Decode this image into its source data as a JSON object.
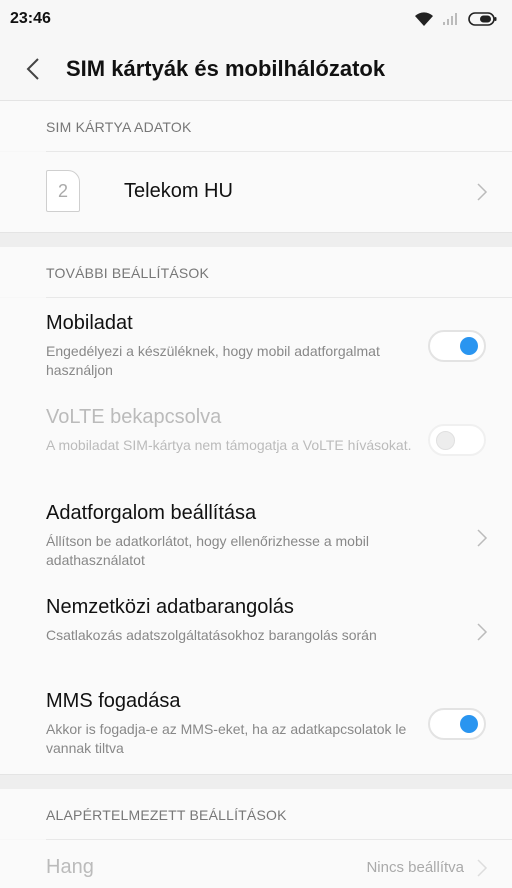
{
  "status": {
    "time": "23:46"
  },
  "header": {
    "title": "SIM kártyák és mobilhálózatok"
  },
  "sim_section": {
    "label": "SIM KÁRTYA ADATOK",
    "sim": {
      "slot_number": "2",
      "operator": "Telekom HU"
    }
  },
  "more_section": {
    "label": "TOVÁBBI BEÁLLÍTÁSOK",
    "items": [
      {
        "title": "Mobiladat",
        "subtitle": "Engedélyezi a készüléknek, hogy mobil adatforgalmat használjon",
        "toggle": "on"
      },
      {
        "title": "VoLTE bekapcsolva",
        "subtitle": "A mobiladat SIM-kártya nem támogatja a VoLTE hívásokat.",
        "toggle": "off-disabled"
      },
      {
        "title": "Adatforgalom beállítása",
        "subtitle": "Állítson be adatkorlátot, hogy ellenőrizhesse a mobil adathasználatot"
      },
      {
        "title": "Nemzetközi adatbarangolás",
        "subtitle": "Csatlakozás adatszolgáltatásokhoz barangolás során"
      },
      {
        "title": "MMS fogadása",
        "subtitle": "Akkor is fogadja-e az MMS-eket, ha az adatkapcsolatok le vannak tiltva",
        "toggle": "on"
      }
    ]
  },
  "default_section": {
    "label": "ALAPÉRTELMEZETT BEÁLLÍTÁSOK",
    "items": [
      {
        "title": "Hang",
        "value": "Nincs beállítva"
      }
    ]
  },
  "colors": {
    "accent": "#2a95f0"
  }
}
